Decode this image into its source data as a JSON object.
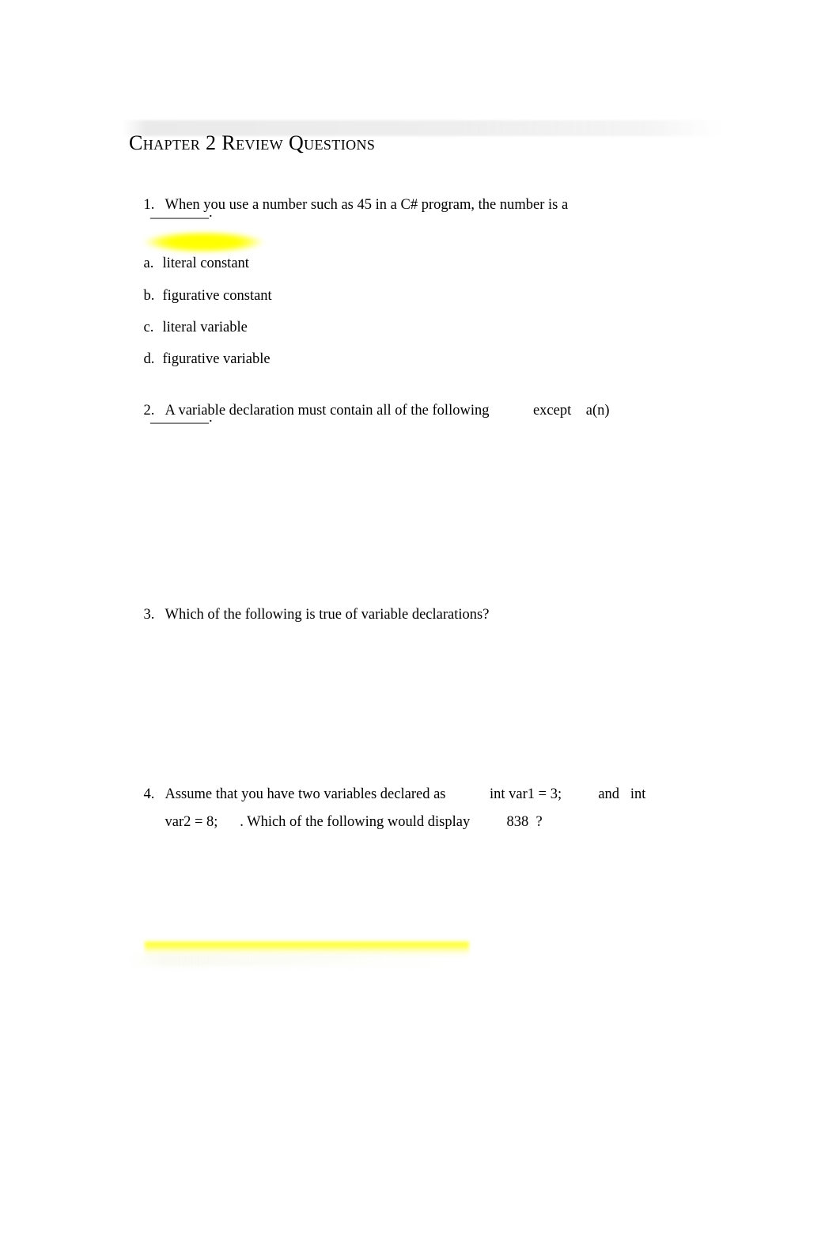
{
  "document": {
    "title": "Chapter 2 Review Questions",
    "background_color": "#ffffff",
    "text_color": "#000000",
    "highlight_color": "#ffff00",
    "header_band_color": "#ededed"
  },
  "questions": [
    {
      "number": "1.",
      "line1": "When you use a number such as 45 in a C# program, the number is a",
      "blank": "________.",
      "options": [
        {
          "letter": "a.",
          "label": "literal constant",
          "highlighted": true
        },
        {
          "letter": "b.",
          "label": "figurative constant",
          "highlighted": false
        },
        {
          "letter": "c.",
          "label": "literal variable",
          "highlighted": false
        },
        {
          "letter": "d.",
          "label": "figurative variable",
          "highlighted": false
        }
      ]
    },
    {
      "number": "2.",
      "line1": "A variable declaration must contain all of the following            except    a(n)",
      "blank": "________."
    },
    {
      "number": "3.",
      "line1": "Which of the following is true of variable declarations?"
    },
    {
      "number": "4.",
      "line1": "Assume that you have two variables declared as            int var1 = 3;          and   int",
      "line2": "var2 = 8;      . Which of the following would display          838  ?"
    }
  ]
}
